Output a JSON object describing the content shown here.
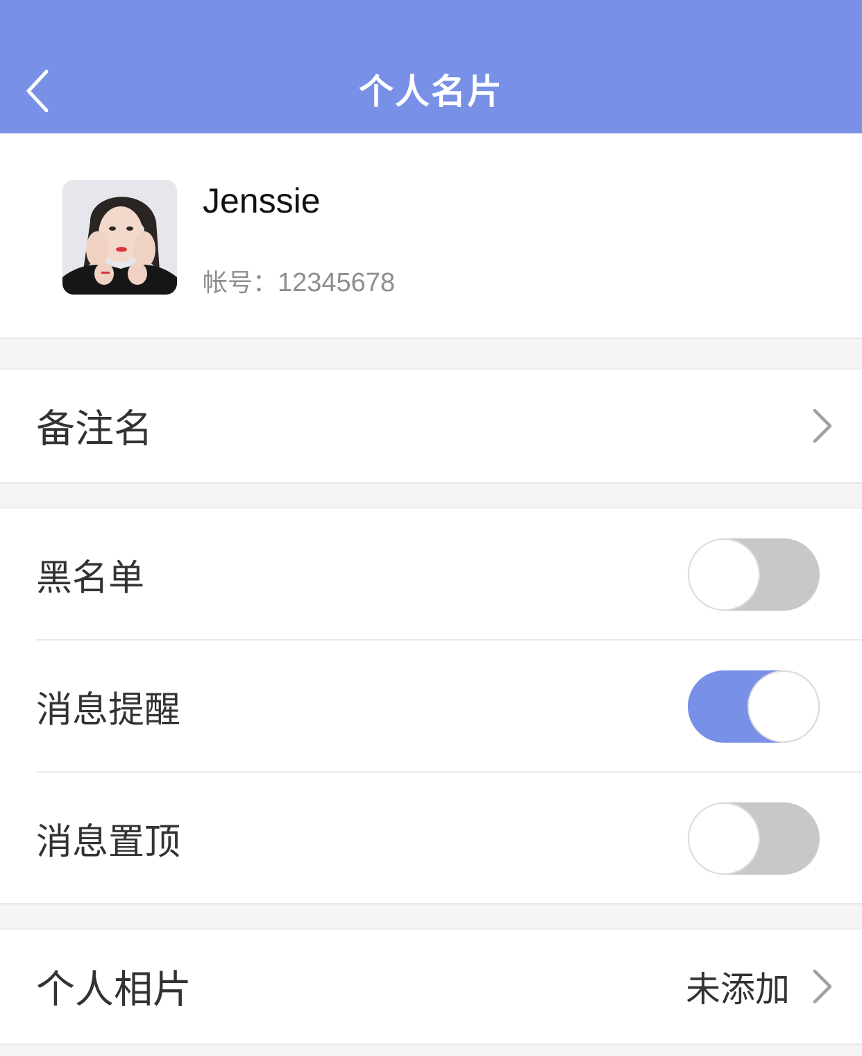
{
  "navbar": {
    "title": "个人名片",
    "background": "#7890e6",
    "back_icon": "chevron-left-icon"
  },
  "profile": {
    "name": "Jenssie",
    "account_label": "帐号：",
    "account_value": "12345678"
  },
  "rows": {
    "remark": {
      "label": "备注名"
    },
    "blacklist": {
      "label": "黑名单",
      "toggle_on": false
    },
    "notify": {
      "label": "消息提醒",
      "toggle_on": true
    },
    "pin": {
      "label": "消息置顶",
      "toggle_on": false
    },
    "photos": {
      "label": "个人相片",
      "value": "未添加"
    }
  },
  "colors": {
    "accent": "#7890e6",
    "toggle_off": "#c8c8cb"
  }
}
